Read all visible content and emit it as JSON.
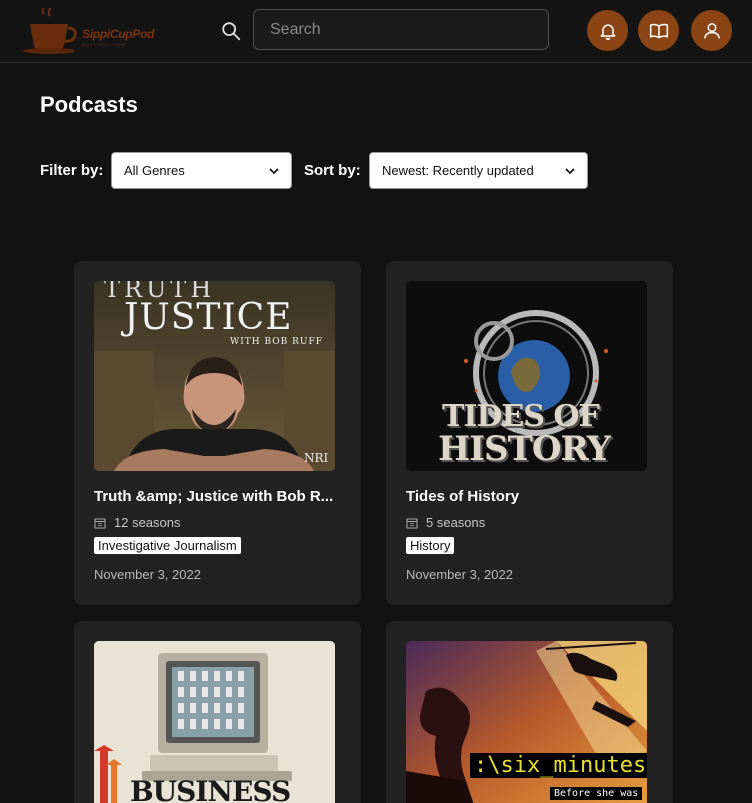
{
  "header": {
    "logo_text": "SippiCupPod",
    "logo_tagline": "Sip • Listen • Relax",
    "search_placeholder": "Search",
    "icons": [
      "bell-icon",
      "book-icon",
      "user-icon"
    ],
    "accent_color": "#8b4514"
  },
  "page": {
    "title": "Podcasts"
  },
  "filters": {
    "filter_label": "Filter by:",
    "filter_value": "All Genres",
    "sort_label": "Sort by:",
    "sort_value": "Newest: Recently updated"
  },
  "podcasts": [
    {
      "title": "Truth &amp; Justice with Bob R...",
      "seasons": "12 seasons",
      "genre": "Investigative Journalism",
      "date": "November 3, 2022",
      "cover_text_1": "TRUTH",
      "cover_text_2": "JUSTICE",
      "cover_text_3": "WITH BOB RUFF",
      "cover_text_4": "NRI"
    },
    {
      "title": "Tides of History",
      "seasons": "5 seasons",
      "genre": "History",
      "date": "November 3, 2022",
      "cover_text_1": "TIDES OF",
      "cover_text_2": "HISTORY"
    },
    {
      "title": "",
      "cover_text_1": "BUSINESS"
    },
    {
      "title": "",
      "cover_text_1": ":\\six_minutes",
      "cover_text_2": "Before she was"
    }
  ]
}
